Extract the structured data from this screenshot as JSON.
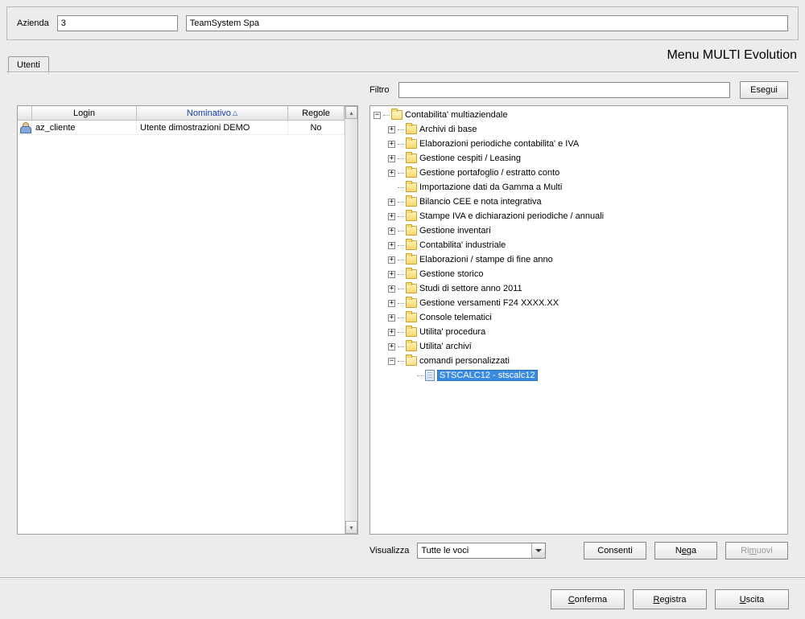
{
  "header": {
    "label_azienda": "Azienda",
    "code": "3",
    "name": "TeamSystem Spa"
  },
  "title": "Menu MULTI Evolution",
  "tab": {
    "utenti": "Utenti"
  },
  "filter": {
    "label": "Filtro",
    "value": "",
    "esegui": "Esegui"
  },
  "users": {
    "headers": {
      "login": "Login",
      "nominativo": "Nominativo",
      "regole": "Regole"
    },
    "rows": [
      {
        "login": "az_cliente",
        "nominativo": "Utente dimostrazioni DEMO",
        "regole": "No"
      }
    ]
  },
  "tree": {
    "root": "Contabilita' multiaziendale",
    "children": [
      {
        "label": "Archivi di base",
        "expandable": true
      },
      {
        "label": "Elaborazioni periodiche contabilita' e IVA",
        "expandable": true
      },
      {
        "label": "Gestione cespiti / Leasing",
        "expandable": true
      },
      {
        "label": "Gestione portafoglio / estratto conto",
        "expandable": true
      },
      {
        "label": "Importazione dati da Gamma a Multi",
        "expandable": false
      },
      {
        "label": "Bilancio CEE e nota integrativa",
        "expandable": true
      },
      {
        "label": "Stampe IVA e dichiarazioni periodiche / annuali",
        "expandable": true
      },
      {
        "label": "Gestione inventari",
        "expandable": true
      },
      {
        "label": "Contabilita' industriale",
        "expandable": true
      },
      {
        "label": "Elaborazioni / stampe di fine anno",
        "expandable": true
      },
      {
        "label": "Gestione storico",
        "expandable": true
      },
      {
        "label": "Studi di settore anno 2011",
        "expandable": true
      },
      {
        "label": "Gestione versamenti F24 XXXX.XX",
        "expandable": true
      },
      {
        "label": "Console telematici",
        "expandable": true
      },
      {
        "label": "Utilita' procedura",
        "expandable": true
      },
      {
        "label": "Utilita' archivi",
        "expandable": true
      }
    ],
    "custom": {
      "label": "comandi personalizzati",
      "item": "STSCALC12 - stscalc12"
    }
  },
  "visualize": {
    "label": "Visualizza",
    "selected": "Tutte le voci",
    "consenti": "Consenti",
    "nega_pre": "N",
    "nega_ul": "e",
    "nega_post": "ga",
    "rimuovi_pre": "Ri",
    "rimuovi_ul": "m",
    "rimuovi_post": "uovi"
  },
  "footer": {
    "conferma_pre": "",
    "conferma_ul": "C",
    "conferma_post": "onferma",
    "registra_pre": "",
    "registra_ul": "R",
    "registra_post": "egistra",
    "uscita_pre": "",
    "uscita_ul": "U",
    "uscita_post": "scita"
  }
}
